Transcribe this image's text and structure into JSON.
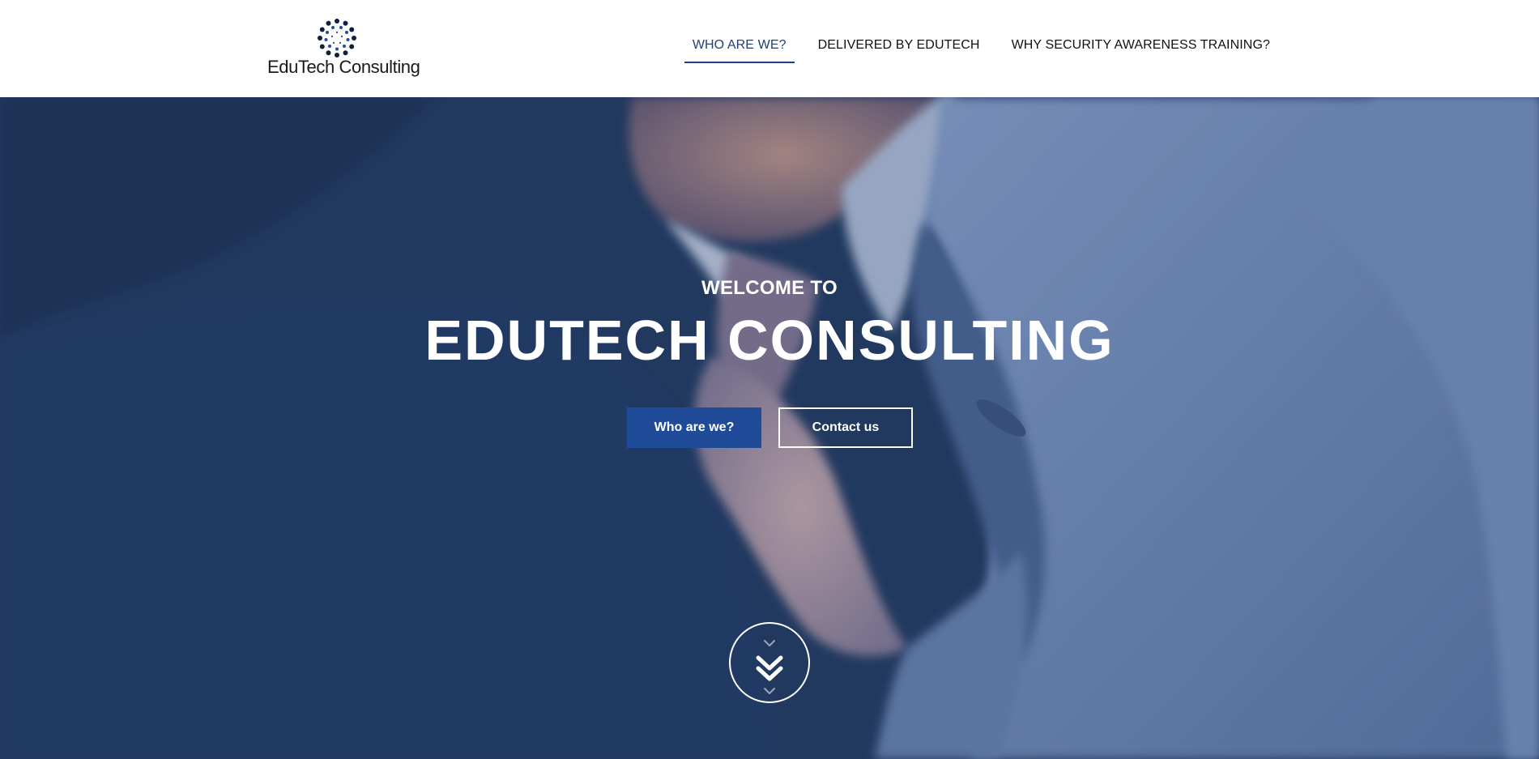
{
  "header": {
    "logo_text": "EduTech Consulting",
    "nav": [
      {
        "label": "WHO ARE WE?",
        "active": true
      },
      {
        "label": "DELIVERED BY EDUTECH",
        "active": false
      },
      {
        "label": "WHY SECURITY AWARENESS TRAINING?",
        "active": false
      }
    ]
  },
  "hero": {
    "eyebrow": "WELCOME TO",
    "title": "EDUTECH CONSULTING",
    "primary_button": "Who are we?",
    "secondary_button": "Contact us",
    "scroll_icon": "double-chevron-down-icon"
  },
  "colors": {
    "accent": "#1f4b99",
    "nav_active": "#1f3f7a",
    "hero_tint": "#23395d",
    "text_light": "#ffffff"
  }
}
